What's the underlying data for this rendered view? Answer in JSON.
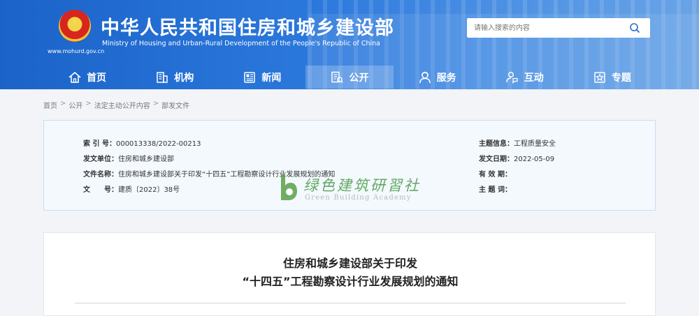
{
  "header": {
    "title": "中华人民共和国住房和城乡建设部",
    "subtitle": "Ministry of Housing and Urban-Rural Development of the People's Republic of China",
    "url": "www.mohurd.gov.cn"
  },
  "search": {
    "placeholder": "请输入搜索的内容",
    "icon": "search-icon"
  },
  "nav": {
    "items": [
      {
        "label": "首页",
        "icon": "home-icon"
      },
      {
        "label": "机构",
        "icon": "building-icon"
      },
      {
        "label": "新闻",
        "icon": "news-icon"
      },
      {
        "label": "公开",
        "icon": "document-icon",
        "active": true
      },
      {
        "label": "服务",
        "icon": "service-icon"
      },
      {
        "label": "互动",
        "icon": "interaction-icon"
      },
      {
        "label": "专题",
        "icon": "topic-icon"
      }
    ]
  },
  "breadcrumb": [
    "首页",
    "公开",
    "法定主动公开内容",
    "部发文件"
  ],
  "info": {
    "index_label": "索 引 号：",
    "index_value": "000013338/2022-00213",
    "issuer_label": "发文单位：",
    "issuer_value": "住房和城乡建设部",
    "name_label": "文件名称：",
    "name_value": "住房和城乡建设部关于印发“十四五”工程勘察设计行业发展规划的通知",
    "docno_label": "文　　号：",
    "docno_value": "建质〔2022〕38号",
    "topic_label": "主题信息：",
    "topic_value": "工程质量安全",
    "date_label": "发文日期：",
    "date_value": "2022-05-09",
    "valid_label": "有 效 期：",
    "valid_value": "",
    "keyword_label": "主 题 词：",
    "keyword_value": ""
  },
  "watermark": {
    "cn": "绿色建筑研習社",
    "en": "Green Building Academy"
  },
  "article": {
    "title_line1": "住房和城乡建设部关于印发",
    "title_line2": "“十四五”工程勘察设计行业发展规划的通知"
  },
  "colors": {
    "header_blue": "#1b63c9",
    "info_bg": "#f4f9fe",
    "watermark_green": "#4a9a4a"
  }
}
